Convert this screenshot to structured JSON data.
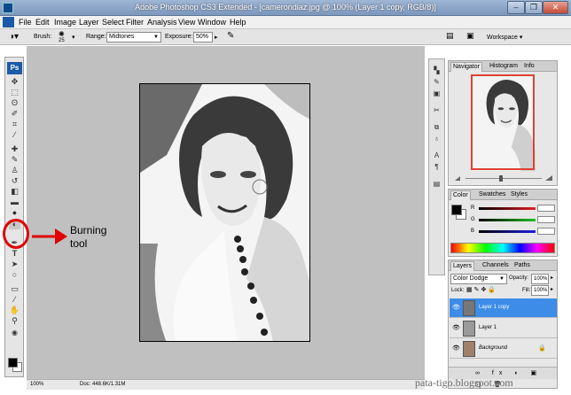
{
  "window": {
    "title": "Adobe Photoshop CS3 Extended - [camerondiaz.jpg @ 100% (Layer 1 copy, RGB/8)]",
    "min": "–",
    "max": "❐",
    "close": "✕"
  },
  "menubar": {
    "items": [
      "File",
      "Edit",
      "Image",
      "Layer",
      "Select",
      "Filter",
      "Analysis",
      "View",
      "Window",
      "Help"
    ]
  },
  "options": {
    "brush_label": "Brush:",
    "brush_size": "25",
    "range_label": "Range:",
    "range_value": "Midtones",
    "exposure_label": "Exposure:",
    "exposure_value": "50%",
    "workspace_label": "Workspace ▾"
  },
  "toolbox": {
    "badge": "Ps"
  },
  "annotation": {
    "label": "Burning\ntool",
    "arrow_icon": "red-arrow-icon"
  },
  "statusbar": {
    "zoom": "100%",
    "doc": "Doc: 448.6K/1.31M"
  },
  "navigator": {
    "tabs": [
      "Navigator",
      "Histogram",
      "Info"
    ]
  },
  "color": {
    "tabs": [
      "Color",
      "Swatches",
      "Styles"
    ],
    "channels": [
      {
        "label": "R",
        "color": "#e02020"
      },
      {
        "label": "G",
        "color": "#20c020"
      },
      {
        "label": "B",
        "color": "#2020e0"
      }
    ]
  },
  "layers": {
    "tabs": [
      "Layers",
      "Channels",
      "Paths"
    ],
    "blend_mode": "Color Dodge",
    "opacity_label": "Opacity:",
    "opacity_value": "100%",
    "lock_label": "Lock:",
    "fill_label": "Fill:",
    "fill_value": "100%",
    "rows": [
      {
        "name": "Layer 1 copy",
        "selected": true
      },
      {
        "name": "Layer 1",
        "selected": false
      },
      {
        "name": "Background",
        "selected": false
      }
    ]
  },
  "watermark": "pata-tigo.blogspot.com"
}
